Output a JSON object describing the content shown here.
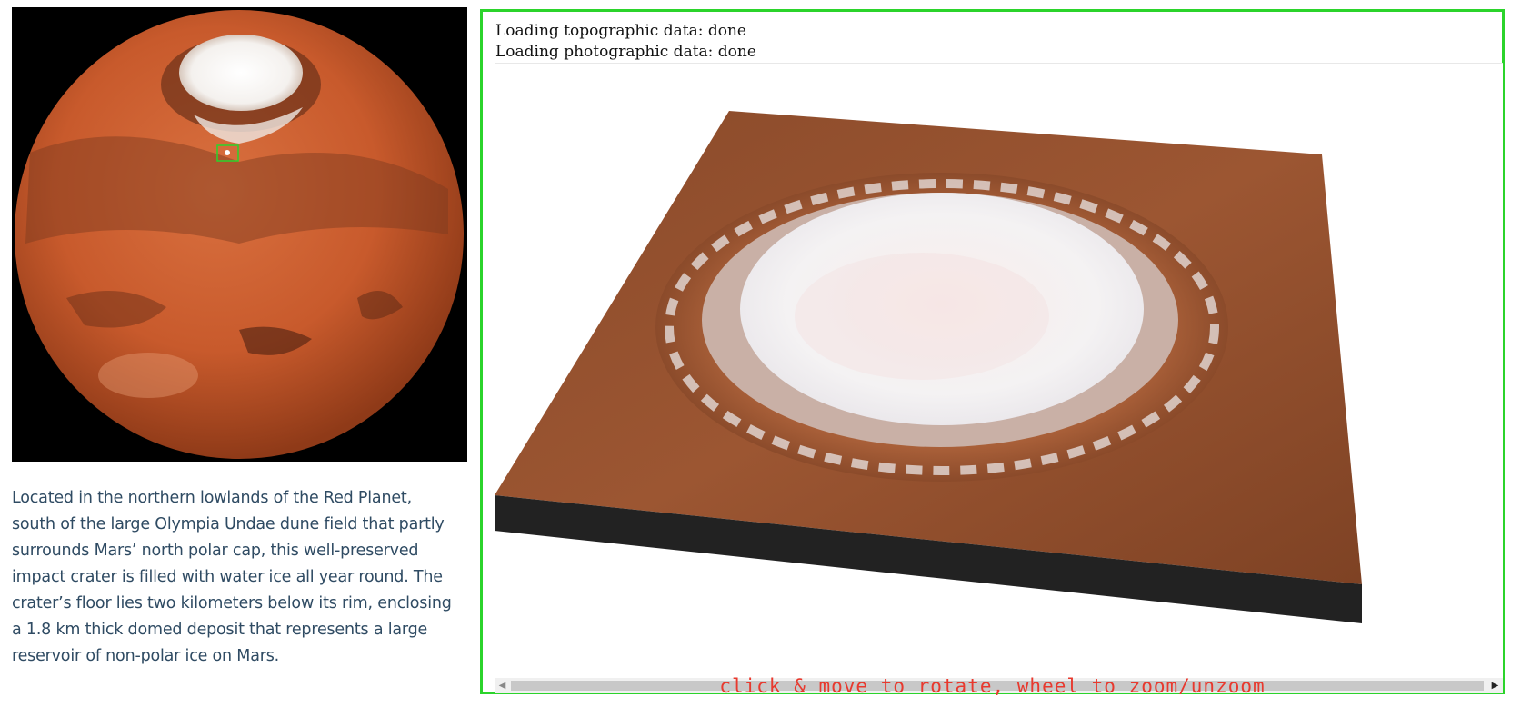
{
  "globe": {
    "alt": "Mars globe with marked crater location",
    "marker_color": "#2bd42b"
  },
  "caption": {
    "lines": [
      "Located in the northern lowlands of the Red Planet,",
      "south of the large Olympia Undae dune field that partly",
      "surrounds Mars’ north polar cap, this well-preserved",
      "impact crater is filled with water ice all year round. The",
      "crater’s floor lies two kilometers below its rim, enclosing",
      "a 1.8 km thick domed deposit that represents a large",
      "reservoir of non-polar ice on Mars."
    ]
  },
  "viewer": {
    "status_lines": [
      "Loading topographic data: done",
      "Loading photographic data: done"
    ],
    "hint": "click & move to rotate, wheel to zoom/unzoom",
    "border_color": "#2bd42b",
    "hint_color": "#e8392e"
  },
  "icons": {
    "scroll_left": "scroll-left-arrow-icon",
    "scroll_right": "scroll-right-arrow-icon"
  }
}
